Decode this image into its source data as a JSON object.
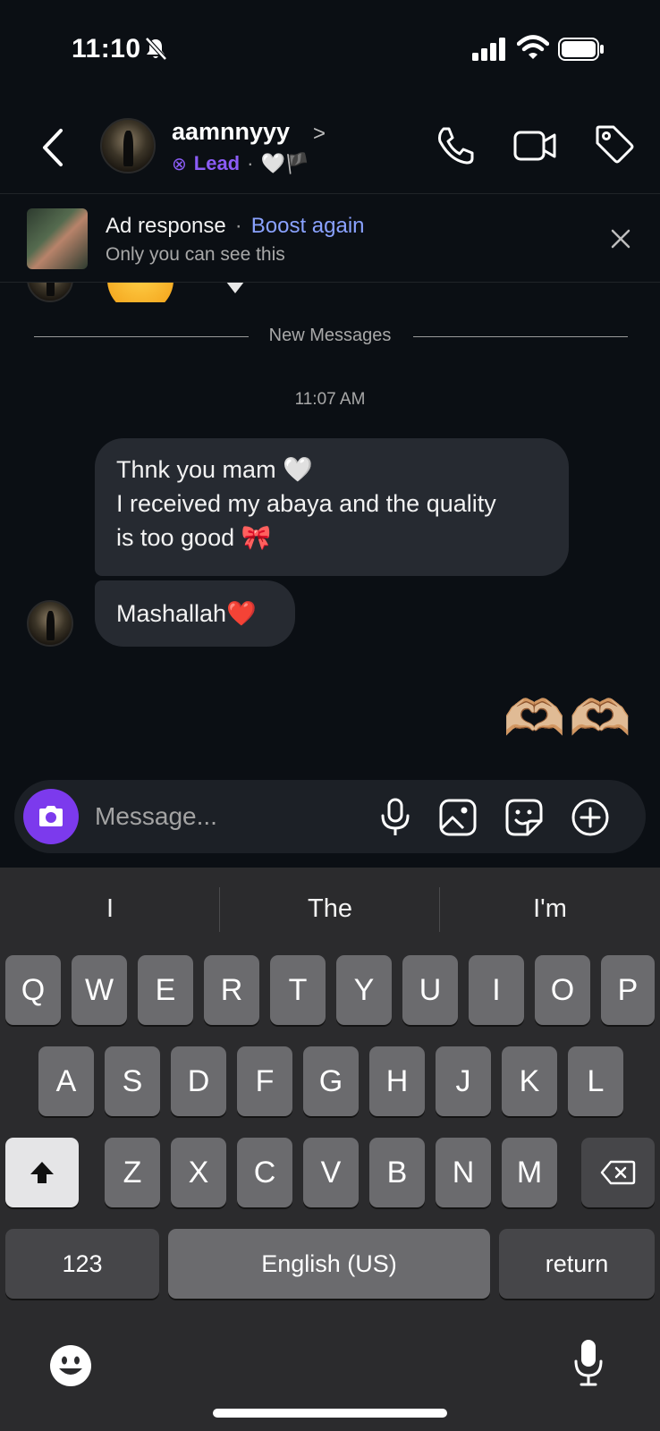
{
  "status_bar": {
    "time": "11:10"
  },
  "header": {
    "username": "aamnnyyy",
    "chevron": ">",
    "lead_icon": "⊗",
    "lead_label": "Lead",
    "dot": "·",
    "status_emojis": "🤍🏴"
  },
  "ad_banner": {
    "title": "Ad response",
    "dot": "·",
    "boost_label": "Boost again",
    "subtitle": "Only you can see this"
  },
  "chat": {
    "divider_label": "New Messages",
    "timestamp": "11:07 AM",
    "messages": [
      {
        "lines": [
          "Thnk you mam 🤍",
          "I received my abaya and the quality",
          "is too good 🎀"
        ]
      },
      {
        "lines": [
          "Mashallah❤️"
        ]
      }
    ],
    "sent_emojis": "🫶🏼🫶🏼"
  },
  "composer": {
    "placeholder": "Message..."
  },
  "keyboard": {
    "suggestions": [
      "I",
      "The",
      "I'm"
    ],
    "row1": [
      "Q",
      "W",
      "E",
      "R",
      "T",
      "Y",
      "U",
      "I",
      "O",
      "P"
    ],
    "row2": [
      "A",
      "S",
      "D",
      "F",
      "G",
      "H",
      "J",
      "K",
      "L"
    ],
    "row3": [
      "Z",
      "X",
      "C",
      "V",
      "B",
      "N",
      "M"
    ],
    "numbers_label": "123",
    "space_label": "English (US)",
    "return_label": "return"
  },
  "colors": {
    "accent": "#7c3aed",
    "link": "#8aa2ff",
    "bubble": "#262a31",
    "background": "#0b0f14"
  },
  "icons": [
    "bell-off-icon",
    "signal-icon",
    "wifi-icon",
    "battery-icon",
    "back-icon",
    "phone-icon",
    "video-icon",
    "tag-icon",
    "close-icon",
    "camera-icon",
    "mic-icon",
    "gallery-icon",
    "sticker-icon",
    "plus-icon",
    "shift-icon",
    "backspace-icon",
    "emoji-icon",
    "dictation-icon"
  ]
}
